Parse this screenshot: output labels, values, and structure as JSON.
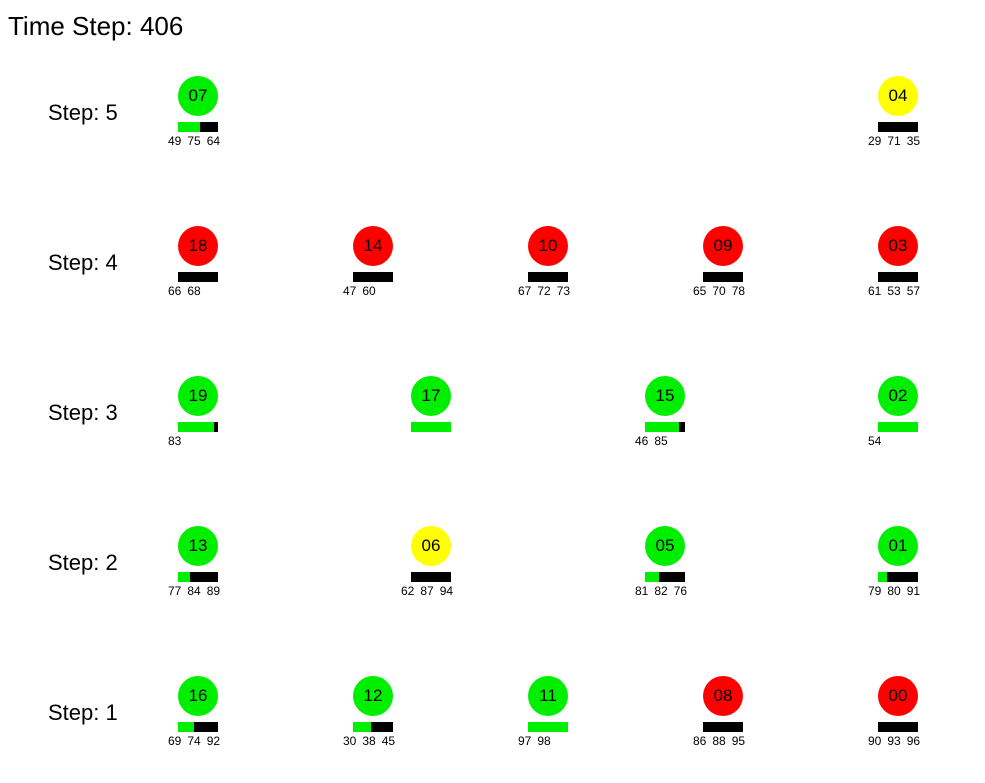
{
  "title": "Time Step: 406",
  "colors": {
    "green": "#00ee00",
    "yellow": "#ffff00",
    "red": "#ff0000",
    "bar_bg": "#000000"
  },
  "steps": [
    {
      "label": "Step: 5",
      "nodes": [
        {
          "id": "07",
          "color": "green",
          "fill": 0.55,
          "queue": [
            "49",
            "75",
            "64"
          ]
        },
        {
          "id": "04",
          "color": "yellow",
          "fill": 0,
          "queue": [
            "29",
            "71",
            "35"
          ]
        }
      ]
    },
    {
      "label": "Step: 4",
      "nodes": [
        {
          "id": "18",
          "color": "red",
          "fill": 0,
          "queue": [
            "66",
            "68"
          ]
        },
        {
          "id": "14",
          "color": "red",
          "fill": 0,
          "queue": [
            "47",
            "60"
          ]
        },
        {
          "id": "10",
          "color": "red",
          "fill": 0,
          "queue": [
            "67",
            "72",
            "73"
          ]
        },
        {
          "id": "09",
          "color": "red",
          "fill": 0,
          "queue": [
            "65",
            "70",
            "78"
          ]
        },
        {
          "id": "03",
          "color": "red",
          "fill": 0,
          "queue": [
            "61",
            "53",
            "57"
          ]
        }
      ]
    },
    {
      "label": "Step: 3",
      "nodes": [
        {
          "id": "19",
          "color": "green",
          "fill": 0.9,
          "queue": [
            "83"
          ]
        },
        {
          "id": "17",
          "color": "green",
          "fill": 1.0,
          "queue": []
        },
        {
          "id": "15",
          "color": "green",
          "fill": 0.85,
          "queue": [
            "46",
            "85"
          ]
        },
        {
          "id": "02",
          "color": "green",
          "fill": 1.0,
          "queue": [
            "54"
          ]
        }
      ]
    },
    {
      "label": "Step: 2",
      "nodes": [
        {
          "id": "13",
          "color": "green",
          "fill": 0.3,
          "queue": [
            "77",
            "84",
            "89"
          ]
        },
        {
          "id": "06",
          "color": "yellow",
          "fill": 0,
          "queue": [
            "62",
            "87",
            "94"
          ]
        },
        {
          "id": "05",
          "color": "green",
          "fill": 0.35,
          "queue": [
            "81",
            "82",
            "76"
          ]
        },
        {
          "id": "01",
          "color": "green",
          "fill": 0.22,
          "queue": [
            "79",
            "80",
            "91"
          ]
        }
      ]
    },
    {
      "label": "Step: 1",
      "nodes": [
        {
          "id": "16",
          "color": "green",
          "fill": 0.4,
          "queue": [
            "69",
            "74",
            "92"
          ]
        },
        {
          "id": "12",
          "color": "green",
          "fill": 0.45,
          "queue": [
            "30",
            "38",
            "45"
          ]
        },
        {
          "id": "11",
          "color": "green",
          "fill": 1.0,
          "queue": [
            "97",
            "98"
          ]
        },
        {
          "id": "08",
          "color": "red",
          "fill": 0,
          "queue": [
            "86",
            "88",
            "95"
          ]
        },
        {
          "id": "00",
          "color": "red",
          "fill": 0,
          "queue": [
            "90",
            "93",
            "96"
          ]
        }
      ]
    }
  ]
}
